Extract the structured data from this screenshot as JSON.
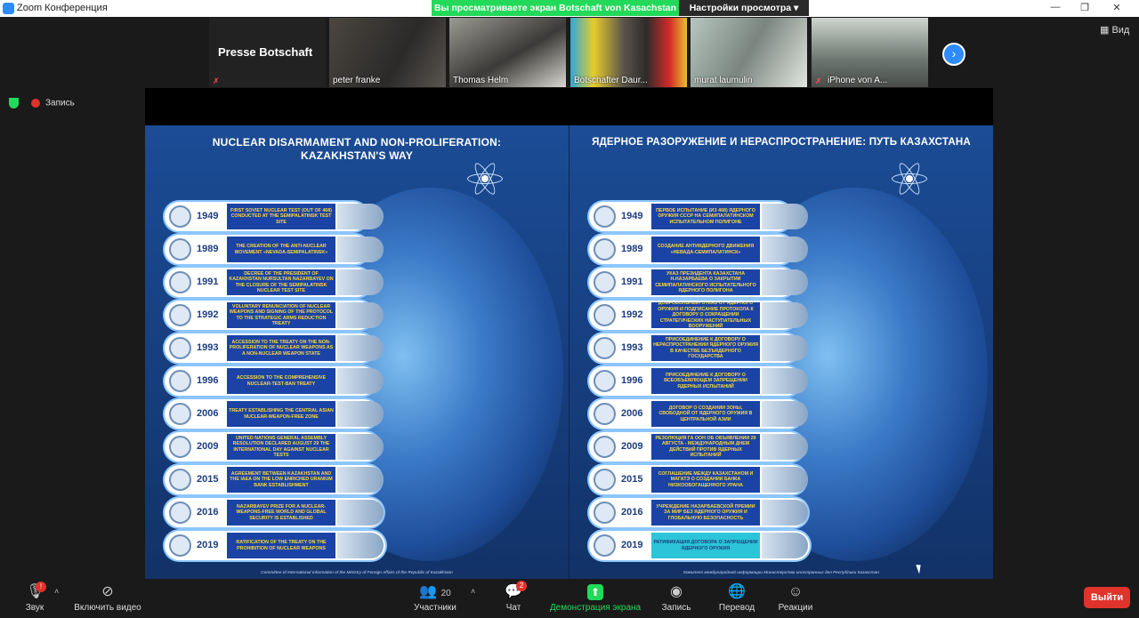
{
  "window": {
    "title": "Zoom Конференция"
  },
  "share_banner": {
    "text": "Вы просматриваете экран Botschaft von Kasachstan"
  },
  "view_options": {
    "label": "Настройки просмотра ▾"
  },
  "view_button": {
    "label": "Вид"
  },
  "recording": {
    "label": "Запись"
  },
  "participants_strip": {
    "label_tile": "Presse Botschaft",
    "tiles": [
      {
        "name": "peter franke",
        "muted": false
      },
      {
        "name": "Thomas Helm",
        "muted": false
      },
      {
        "name": "Botschafter Daur...",
        "muted": false
      },
      {
        "name": "murat laumulin",
        "muted": false
      },
      {
        "name": "iPhone von A...",
        "muted": true
      }
    ]
  },
  "poster": {
    "left": {
      "title": "NUCLEAR DISARMAMENT AND NON-PROLIFERATION: KAZAKHSTAN'S WAY",
      "footer": "Committee of International Information of the Ministry of Foreign Affairs of the Republic of Kazakhstan",
      "rows": [
        {
          "year": "1949",
          "text": "FIRST SOVIET NUCLEAR TEST (OUT OF 468) CONDUCTED AT THE SEMIPALATINSK TEST SITE",
          "style": "blue"
        },
        {
          "year": "1989",
          "text": "THE CREATION OF THE ANTI-NUCLEAR MOVEMENT «NEVADA-SEMIPALATINSK»",
          "style": "blue"
        },
        {
          "year": "1991",
          "text": "DECREE OF THE PRESIDENT OF KAZAKHSTAN NURSULTAN NAZARBAYEV ON THE CLOSURE OF THE SEMIPALATINSK NUCLEAR TEST SITE",
          "style": "blue"
        },
        {
          "year": "1992",
          "text": "VOLUNTARY RENUNCIATION OF NUCLEAR WEAPONS AND SIGNING OF THE PROTOCOL TO THE STRATEGIC ARMS REDUCTION TREATY",
          "style": "blue"
        },
        {
          "year": "1993",
          "text": "ACCESSION TO THE TREATY ON THE NON-PROLIFERATION OF NUCLEAR WEAPONS AS A NON-NUCLEAR WEAPON STATE",
          "style": "blue"
        },
        {
          "year": "1996",
          "text": "ACCESSION TO THE COMPREHENSIVE NUCLEAR-TEST-BAN TREATY",
          "style": "blue"
        },
        {
          "year": "2006",
          "text": "TREATY ESTABLISHING THE CENTRAL ASIAN NUCLEAR-WEAPON-FREE ZONE",
          "style": "blue"
        },
        {
          "year": "2009",
          "text": "UNITED NATIONS GENERAL ASSEMBLY RESOLUTION DECLARED AUGUST 29 THE INTERNATIONAL DAY AGAINST NUCLEAR TESTS",
          "style": "blue"
        },
        {
          "year": "2015",
          "text": "AGREEMENT BETWEEN KAZAKHSTAN AND THE IAEA ON THE LOW ENRICHED URANIUM BANK ESTABLISHMENT",
          "style": "blue"
        },
        {
          "year": "2016",
          "text": "NAZARBAYEV PRIZE FOR A NUCLEAR-WEAPONS-FREE WORLD AND GLOBAL SECURITY IS ESTABLISHED",
          "style": "blue"
        },
        {
          "year": "2019",
          "text": "RATIFICATION OF THE TREATY ON THE PROHIBITION OF NUCLEAR WEAPONS",
          "style": "blue"
        }
      ]
    },
    "right": {
      "title": "ЯДЕРНОЕ РАЗОРУЖЕНИЕ И НЕРАСПРОСТРАНЕНИЕ: ПУТЬ КАЗАХСТАНА",
      "footer": "Комитет международной информации Министерства иностранных дел Республики Казахстан",
      "rows": [
        {
          "year": "1949",
          "text": "ПЕРВОЕ ИСПЫТАНИЕ (ИЗ 468) ЯДЕРНОГО ОРУЖИЯ СССР НА СЕМИПАЛАТИНСКОМ ИСПЫТАТЕЛЬНОМ ПОЛИГОНЕ",
          "style": "blue"
        },
        {
          "year": "1989",
          "text": "СОЗДАНИЕ АНТИЯДЕРНОГО ДВИЖЕНИЯ «НЕВАДА-СЕМИПАЛАТИНСК»",
          "style": "blue"
        },
        {
          "year": "1991",
          "text": "УКАЗ ПРЕЗИДЕНТА КАЗАХСТАНА Н.НАЗАРБАЕВА О ЗАКРЫТИИ СЕМИПАЛАТИНСКОГО ИСПЫТАТЕЛЬНОГО ЯДЕРНОГО ПОЛИГОНА",
          "style": "blue"
        },
        {
          "year": "1992",
          "text": "ДОБРОВОЛЬНЫЙ ОТКАЗ ОТ ЯДЕРНОГО ОРУЖИЯ И ПОДПИСАНИЕ ПРОТОКОЛА К ДОГОВОРУ О СОКРАЩЕНИИ СТРАТЕГИЧЕСКИХ НАСТУПАТЕЛЬНЫХ ВООРУЖЕНИЙ",
          "style": "blue"
        },
        {
          "year": "1993",
          "text": "ПРИСОЕДИНЕНИЕ К ДОГОВОРУ О НЕРАСПРОСТРАНЕНИИ ЯДЕРНОГО ОРУЖИЯ В КАЧЕСТВЕ БЕЗЪЯДЕРНОГО ГОСУДАРСТВА",
          "style": "blue"
        },
        {
          "year": "1996",
          "text": "ПРИСОЕДИНЕНИЕ К ДОГОВОРУ О ВСЕОБЪЕМЛЮЩЕМ ЗАПРЕЩЕНИИ ЯДЕРНЫХ ИСПЫТАНИЙ",
          "style": "blue"
        },
        {
          "year": "2006",
          "text": "ДОГОВОР О СОЗДАНИИ ЗОНЫ, СВОБОДНОЙ ОТ ЯДЕРНОГО ОРУЖИЯ В ЦЕНТРАЛЬНОЙ АЗИИ",
          "style": "blue"
        },
        {
          "year": "2009",
          "text": "РЕЗОЛЮЦИЯ ГА ООН ОБ ОБЪЯВЛЕНИИ 29 АВГУСТА - МЕЖДУНАРОДНЫМ ДНЕМ ДЕЙСТВИЙ ПРОТИВ ЯДЕРНЫХ ИСПЫТАНИЙ",
          "style": "blue"
        },
        {
          "year": "2015",
          "text": "СОГЛАШЕНИЕ МЕЖДУ КАЗАХСТАНОМ И МАГАТЭ О СОЗДАНИИ БАНКА НИЗКООБОГАЩЕННОГО УРАНА",
          "style": "blue"
        },
        {
          "year": "2016",
          "text": "УЧРЕЖДЕНИЕ НАЗАРБАЕВСКОЙ ПРЕМИИ ЗА МИР БЕЗ ЯДЕРНОГО ОРУЖИЯ И ГЛОБАЛЬНУЮ БЕЗОПАСНОСТЬ",
          "style": "blue"
        },
        {
          "year": "2019",
          "text": "РАТИФИКАЦИЯ ДОГОВОРА О ЗАПРЕЩЕНИИ ЯДЕРНОГО ОРУЖИЯ",
          "style": "cyan"
        }
      ]
    }
  },
  "toolbar": {
    "audio": {
      "label": "Звук",
      "badge": "!"
    },
    "video": {
      "label": "Включить видео"
    },
    "participants": {
      "label": "Участники",
      "count": "20"
    },
    "chat": {
      "label": "Чат",
      "badge": "2"
    },
    "share": {
      "label": "Демонстрация экрана"
    },
    "record": {
      "label": "Запись"
    },
    "translate": {
      "label": "Перевод"
    },
    "reactions": {
      "label": "Реакции"
    },
    "leave": {
      "label": "Выйти"
    }
  },
  "colors": {
    "share_green": "#23d959",
    "leave_red": "#e0332b",
    "zoom_blue": "#2d8cff"
  }
}
